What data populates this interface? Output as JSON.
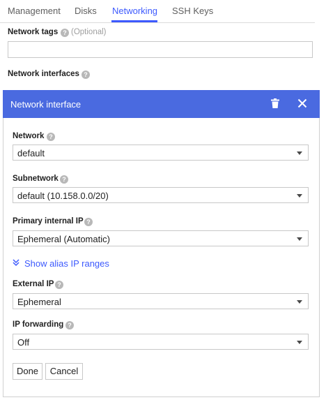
{
  "tabs": [
    {
      "label": "Management"
    },
    {
      "label": "Disks"
    },
    {
      "label": "Networking",
      "active": true
    },
    {
      "label": "SSH Keys"
    }
  ],
  "network_tags": {
    "label": "Network tags",
    "optional": "(Optional)",
    "value": ""
  },
  "network_interfaces": {
    "label": "Network interfaces"
  },
  "panel": {
    "title": "Network interface",
    "network": {
      "label": "Network",
      "value": "default"
    },
    "subnetwork": {
      "label": "Subnetwork",
      "value": "default (10.158.0.0/20)"
    },
    "primary_ip": {
      "label": "Primary internal IP",
      "value": "Ephemeral (Automatic)"
    },
    "alias_link": "Show alias IP ranges",
    "external_ip": {
      "label": "External IP",
      "value": "Ephemeral"
    },
    "ip_forwarding": {
      "label": "IP forwarding",
      "value": "Off"
    },
    "done": "Done",
    "cancel": "Cancel"
  },
  "icons": {
    "help": "help-circle-icon",
    "delete": "trash-icon",
    "close": "close-icon",
    "dropdown": "caret-down-icon",
    "expand": "double-chevron-down-icon"
  },
  "colors": {
    "accent": "#3d5afe",
    "header": "#4a6ae0",
    "help": "#b8b8b8"
  }
}
